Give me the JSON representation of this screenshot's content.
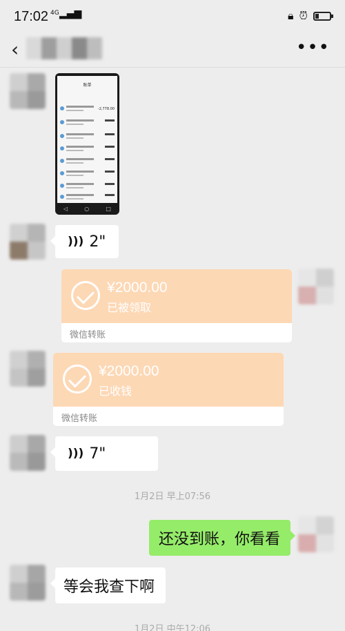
{
  "status_bar": {
    "time": "17:02",
    "network": "4G"
  },
  "header": {
    "back_icon": "‹",
    "more_icon": "•••"
  },
  "thumbnail": {
    "title": "账单",
    "first_amount": "-2,778.00"
  },
  "messages": {
    "voice1": {
      "duration": "2\""
    },
    "transfer1": {
      "amount": "¥2000.00",
      "status": "已被领取",
      "footer": "微信转账"
    },
    "transfer2": {
      "amount": "¥2000.00",
      "status": "已收钱",
      "footer": "微信转账"
    },
    "voice2": {
      "duration": "7\""
    },
    "time1": "1月2日 早上07:56",
    "sent_text": "还没到账，你看看",
    "reply_text": "等会我查下啊",
    "time2": "1月2日 中午12:06"
  },
  "colors": {
    "bubble_green": "#95ec69",
    "transfer_orange": "#fdd8b5",
    "background": "#ededed"
  }
}
